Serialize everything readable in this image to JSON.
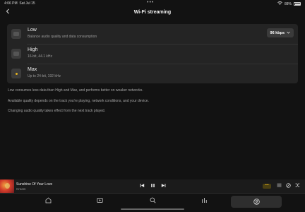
{
  "status_bar": {
    "time": "4:06 PM",
    "date": "Sat Jul 15",
    "battery": "88%",
    "dots": "•••"
  },
  "header": {
    "title": "Wi-Fi streaming"
  },
  "options": [
    {
      "title": "Low",
      "subtitle": "Balance audio quality and data consumption",
      "selected": false
    },
    {
      "title": "High",
      "subtitle": "16-bit, 44.1 kHz",
      "selected": false
    },
    {
      "title": "Max",
      "subtitle": "Up to 24-bit, 192 kHz",
      "selected": true
    }
  ],
  "bitrate": {
    "value": "96 kbps",
    "chevron": "⌄"
  },
  "info": [
    "Low consumes less data than High and Max, and performs better on weaker networks.",
    "Available quality depends on the track you're playing, network conditions, and your device.",
    "Changing audio quality takes effect from the next track played."
  ],
  "player": {
    "track_title": "Sunshine Of Your Love",
    "artist": "Cream",
    "quality_badge": "•••",
    "accent_color": "#e6b420"
  },
  "tabs": [
    "home-icon",
    "video-icon",
    "search-icon",
    "library-icon",
    "profile-icon"
  ]
}
